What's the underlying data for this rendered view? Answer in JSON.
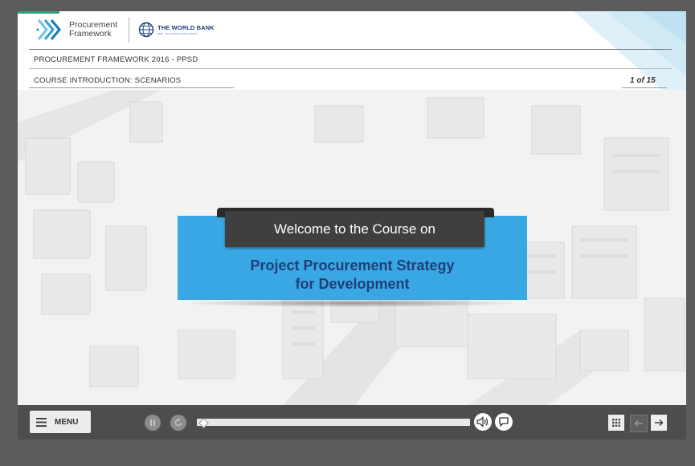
{
  "header": {
    "logo_text_line1": "Procurement",
    "logo_text_line2": "Framework",
    "partner_name": "THE WORLD BANK",
    "partner_tagline": "IBRD · IDA | WORLD BANK GROUP",
    "course_title": "PROCUREMENT FRAMEWORK 2016 - PPSD",
    "section_title": "COURSE INTRODUCTION: SCENARIOS",
    "page_indicator": "1 of 15"
  },
  "banner": {
    "welcome_text": "Welcome to the Course on",
    "course_name_line1": "Project Procurement Strategy",
    "course_name_line2": "for Development",
    "blue_color": "#3aa7e5",
    "dark_color": "#3f3f3f",
    "title_color": "#1e3f78"
  },
  "toolbar": {
    "menu_label": "MENU",
    "progress_fraction": 0.0,
    "icons": [
      "menu-icon",
      "pause-icon",
      "replay-icon",
      "audio-icon",
      "caption-icon",
      "grid-icon",
      "arrow-left-icon",
      "arrow-right-icon"
    ]
  },
  "colors": {
    "accent_green": "#2ea37a",
    "toolbar_bg": "#4d4d4f",
    "outer_bg": "#5c5c5c"
  }
}
